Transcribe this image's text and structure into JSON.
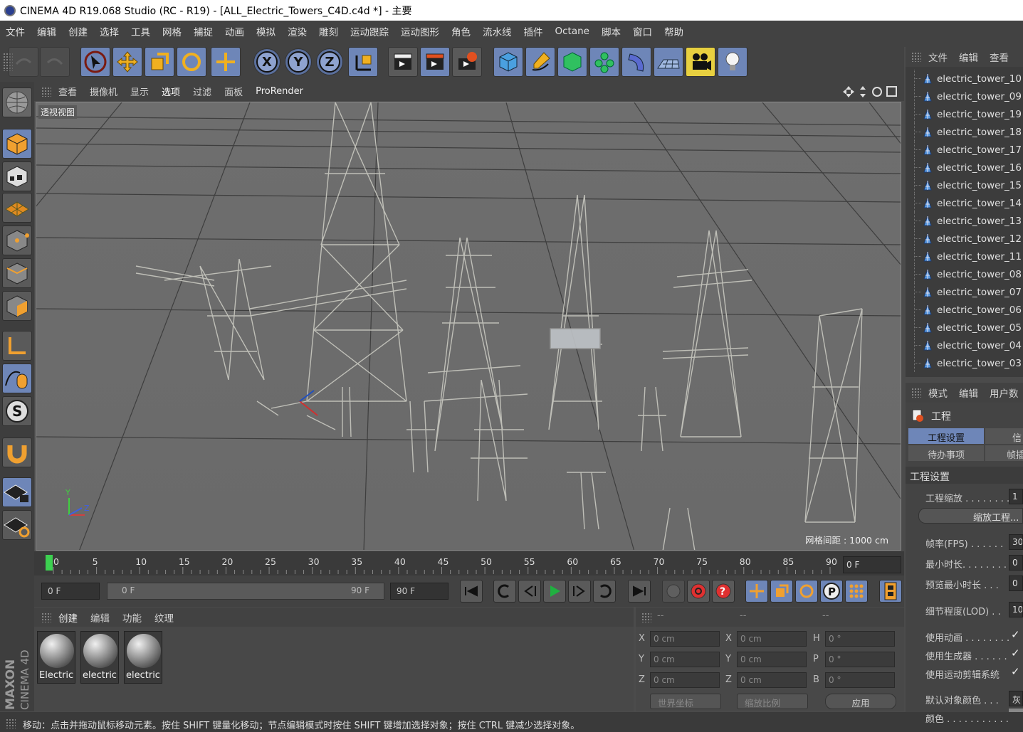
{
  "window": {
    "title": "CINEMA 4D R19.068 Studio (RC - R19) - [ALL_Electric_Towers_C4D.c4d *] - 主要"
  },
  "menu": [
    "文件",
    "编辑",
    "创建",
    "选择",
    "工具",
    "网格",
    "捕捉",
    "动画",
    "模拟",
    "渲染",
    "雕刻",
    "运动跟踪",
    "运动图形",
    "角色",
    "流水线",
    "插件",
    "Octane",
    "脚本",
    "窗口",
    "帮助"
  ],
  "toolbar": {
    "undo_icon": "undo-icon",
    "redo_icon": "redo-icon",
    "axis_x": "X",
    "axis_y": "Y",
    "axis_z": "Z"
  },
  "viewport": {
    "menu": [
      "查看",
      "摄像机",
      "显示",
      "选项",
      "过滤",
      "面板",
      "ProRender"
    ],
    "name": "透视视图",
    "grid_spacing": "网格间距 : 1000 cm",
    "axis_y": "Y",
    "axis_z": "Z"
  },
  "timeline": {
    "ticks": [
      "0",
      "5",
      "10",
      "15",
      "20",
      "25",
      "30",
      "35",
      "40",
      "45",
      "50",
      "55",
      "60",
      "65",
      "70",
      "75",
      "80",
      "85",
      "90"
    ],
    "current_frame": "0 F",
    "start_field": "0 F",
    "range_start": "0 F",
    "range_end": "90 F",
    "end_field": "90 F"
  },
  "materials": {
    "menu": [
      "创建",
      "编辑",
      "功能",
      "纹理"
    ],
    "items": [
      "Electric",
      "electric",
      "electric"
    ]
  },
  "coordinates": {
    "headers": [
      "--",
      "--",
      "--"
    ],
    "rows": [
      {
        "axis": "X",
        "pos": "0 cm",
        "saxis": "X",
        "size": "0 cm",
        "raxis": "H",
        "rot": "0 °"
      },
      {
        "axis": "Y",
        "pos": "0 cm",
        "saxis": "Y",
        "size": "0 cm",
        "raxis": "P",
        "rot": "0 °"
      },
      {
        "axis": "Z",
        "pos": "0 cm",
        "saxis": "Z",
        "size": "0 cm",
        "raxis": "B",
        "rot": "0 °"
      }
    ],
    "world_dropdown": "世界坐标",
    "scale_dropdown": "缩放比例",
    "apply_label": "应用"
  },
  "status": {
    "text": "移动：点击并拖动鼠标移动元素。按住 SHIFT 键量化移动；节点编辑模式时按住 SHIFT 键增加选择对象；按住 CTRL 键减少选择对象。"
  },
  "object_manager": {
    "menu": [
      "文件",
      "编辑",
      "查看"
    ],
    "objects": [
      "electric_tower_10",
      "electric_tower_09",
      "electric_tower_19",
      "electric_tower_18",
      "electric_tower_17",
      "electric_tower_16",
      "electric_tower_15",
      "electric_tower_14",
      "electric_tower_13",
      "electric_tower_12",
      "electric_tower_11",
      "electric_tower_08",
      "electric_tower_07",
      "electric_tower_06",
      "electric_tower_05",
      "electric_tower_04",
      "electric_tower_03"
    ]
  },
  "attributes": {
    "menu": [
      "模式",
      "编辑",
      "用户数"
    ],
    "title": "工程",
    "tabs": [
      "工程设置",
      "信",
      "待办事项",
      "帧插"
    ],
    "section": "工程设置",
    "scale_label": "工程缩放 . . . . . . . .",
    "scale_value": "1",
    "scale_button": "缩放工程...",
    "fps_label": "帧率(FPS) . . . . . .",
    "fps_value": "30",
    "min_time_label": "最小时长. . . . . . . .",
    "min_time_value": "0",
    "preview_min_label": "预览最小时长 . . .",
    "preview_min_value": "0",
    "lod_label": "细节程度(LOD) . .",
    "lod_value": "10",
    "use_anim_label": "使用动画 . . . . . . . .",
    "use_gen_label": "使用生成器 . . . . . .",
    "use_motion_label": "使用运动剪辑系统",
    "default_color_label": "默认对象颜色 . . .",
    "default_color_value": "灰",
    "color_label": "颜色 . . . . . . . . . . .",
    "check": "✓"
  },
  "branding": {
    "maxon": "MAXON",
    "cinema": "CINEMA 4D"
  },
  "colors": {
    "accent_blue": "#6e86b8",
    "viewport_bg": "#6c6c6c",
    "panel_bg": "#424242",
    "green_marker": "#3cd050"
  }
}
